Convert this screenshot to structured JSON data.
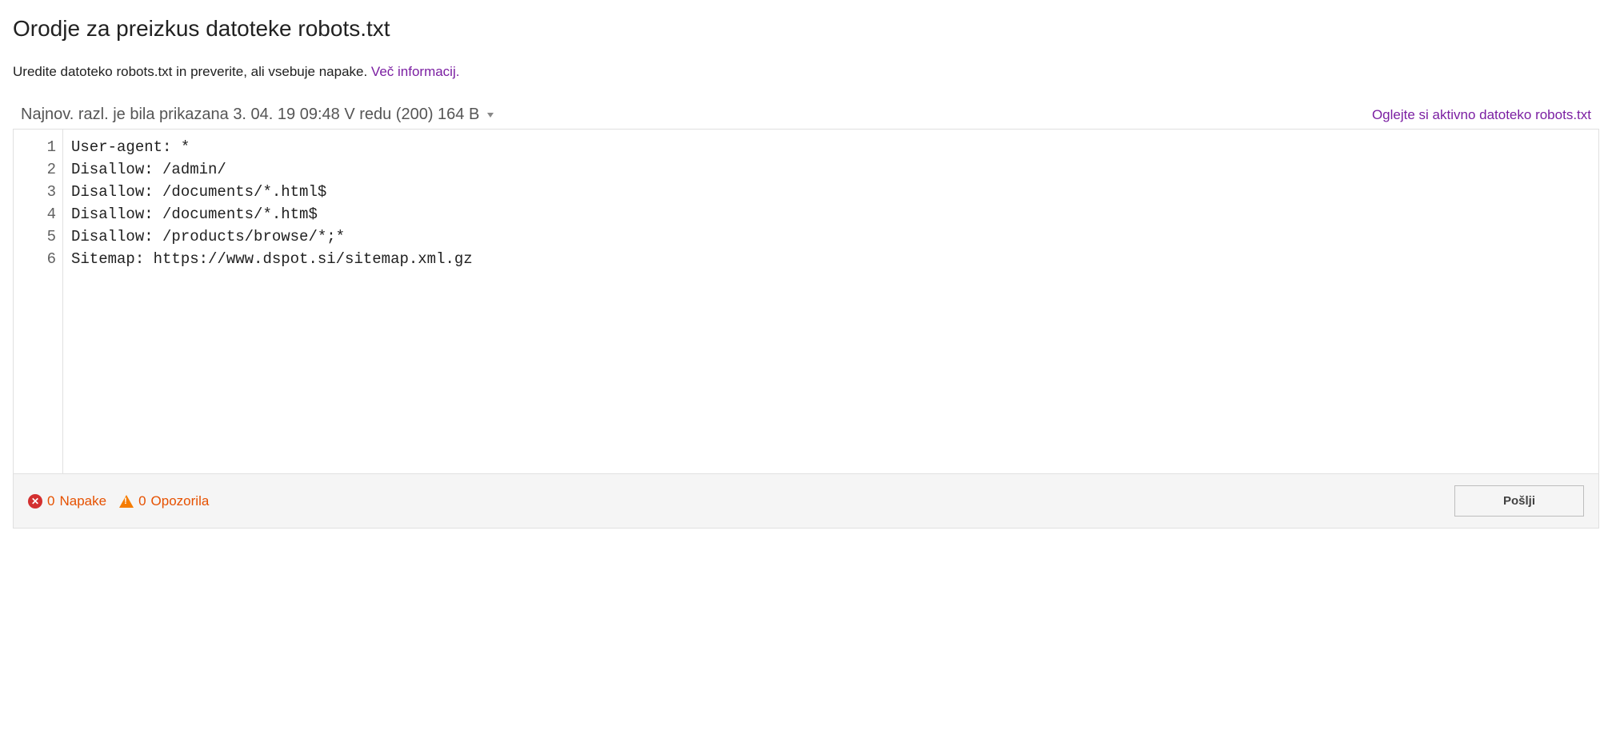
{
  "header": {
    "title": "Orodje za preizkus datoteke robots.txt",
    "description_text": "Uredite datoteko robots.txt in preverite, ali vsebuje napake. ",
    "more_info_link": "Več informacij."
  },
  "status": {
    "latest_version_text": "Najnov. razl. je bila prikazana 3. 04. 19 09:48 V redu (200) 164 B",
    "view_live_link": "Oglejte si aktivno datoteko robots.txt"
  },
  "editor": {
    "lines": [
      "User-agent: *",
      "Disallow: /admin/",
      "Disallow: /documents/*.html$",
      "Disallow: /documents/*.htm$",
      "Disallow: /products/browse/*;*",
      "Sitemap: https://www.dspot.si/sitemap.xml.gz"
    ]
  },
  "footer": {
    "errors_count": "0",
    "errors_label": "Napake",
    "warnings_count": "0",
    "warnings_label": "Opozorila",
    "submit_label": "Pošlji"
  }
}
